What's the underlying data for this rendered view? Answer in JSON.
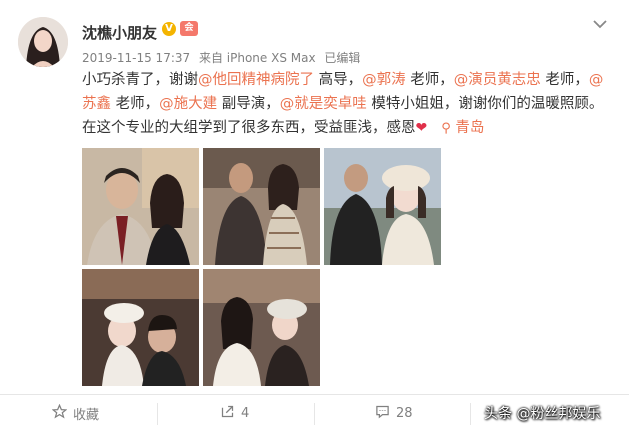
{
  "post": {
    "username": "沈樵小朋友",
    "verified_badge": "V",
    "vip_badge": "会",
    "timestamp": "2019-11-15 17:37",
    "source": "来自 iPhone XS Max",
    "edited": "已编辑",
    "content": {
      "p1": "小巧杀青了，谢谢",
      "m1": "@他回精神病院了",
      "p2": " 高导，",
      "m2": "@郭涛",
      "p3": " 老师，",
      "m3": "@演员黄志忠",
      "p4": " 老师，",
      "m4": "@苏鑫",
      "p5": " 老师，",
      "m5": "@施大建",
      "p6": " 副导演，",
      "m6": "@就是奕卓哇",
      "p7": " 模特小姐姐，谢谢你们的温暖照顾。在这个专业的大组学到了很多东西，受益匪浅，感恩",
      "location": "青岛"
    },
    "icons": {
      "options": "chevron-down-icon",
      "heart": "heart-icon",
      "location": "location-pin-icon"
    }
  },
  "actions": {
    "favorite_label": "收藏",
    "repost_count": "4",
    "comment_count": "28"
  },
  "watermark": "头条 @粉丝邦娱乐",
  "colors": {
    "mention": "#eb7350",
    "text": "#333333",
    "meta": "#808080",
    "heart": "#e0304a"
  }
}
